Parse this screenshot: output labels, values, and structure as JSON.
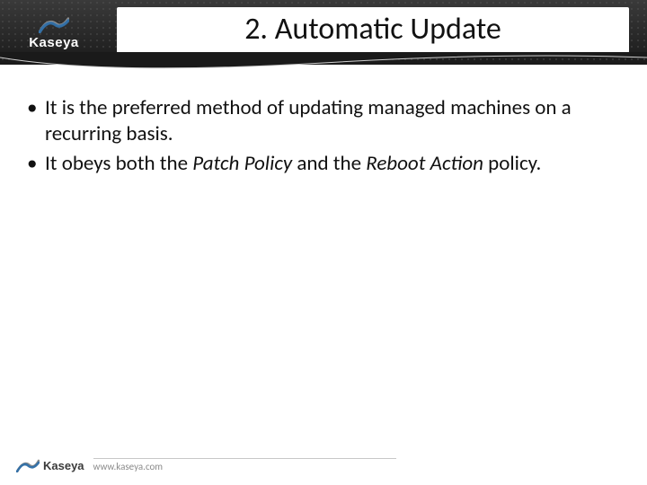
{
  "header": {
    "logo_text": "Kaseya",
    "title": "2. Automatic Update"
  },
  "content": {
    "bullets": [
      {
        "pre": "It is the preferred method of updating managed machines on a recurring basis.",
        "italic1": "",
        "mid": "",
        "italic2": "",
        "post": ""
      },
      {
        "pre": "It obeys both the ",
        "italic1": "Patch Policy",
        "mid": " and the ",
        "italic2": "Reboot Action",
        "post": " policy."
      }
    ]
  },
  "footer": {
    "logo_text": "Kaseya",
    "url": "www.kaseya.com"
  },
  "colors": {
    "logo_blue": "#2f6fa8",
    "logo_gray": "#8d8d8d"
  }
}
